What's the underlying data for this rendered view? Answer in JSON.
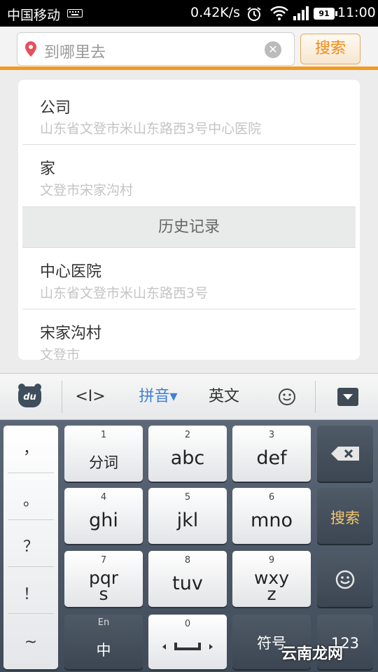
{
  "status_bar": {
    "carrier": "中国移动",
    "network_rate": "0.42K/s",
    "battery": "91",
    "time": "11:00"
  },
  "search": {
    "placeholder": "到哪里去",
    "button_label": "搜索",
    "accent_color": "#f49a1f"
  },
  "list": {
    "favorites": [
      {
        "title": "公司",
        "address": "山东省文登市米山东路西3号中心医院"
      },
      {
        "title": "家",
        "address": "文登市宋家沟村"
      }
    ],
    "history_header": "历史记录",
    "history": [
      {
        "title": "中心医院",
        "address": "山东省文登市米山东路西3号"
      },
      {
        "title": "宋家沟村",
        "address": "文登市"
      }
    ]
  },
  "keyboard_toolbar": {
    "logo_icon": "du-logo-icon",
    "cursor_label": "<I>",
    "pinyin_label": "拼音▾",
    "english_label": "英文",
    "emoji_icon": "smiley-icon",
    "collapse_icon": "collapse-keyboard-icon"
  },
  "keyboard": {
    "punctuation": [
      "，",
      "。",
      "？",
      "！",
      "~"
    ],
    "keys": [
      {
        "num": "1",
        "label": "分词"
      },
      {
        "num": "2",
        "label": "abc"
      },
      {
        "num": "3",
        "label": "def"
      },
      {
        "num": "4",
        "label": "ghi"
      },
      {
        "num": "5",
        "label": "jkl"
      },
      {
        "num": "6",
        "label": "mno"
      },
      {
        "num": "7",
        "label": "pqr\ns"
      },
      {
        "num": "8",
        "label": "tuv"
      },
      {
        "num": "9",
        "label": "wxy\nz"
      }
    ],
    "lang_key": {
      "top": "En",
      "label": "中"
    },
    "space_key": {
      "num": "0"
    },
    "symbol_key": "符号",
    "num_key": "123",
    "search_key": "搜索",
    "watermark": "云南龙网"
  }
}
